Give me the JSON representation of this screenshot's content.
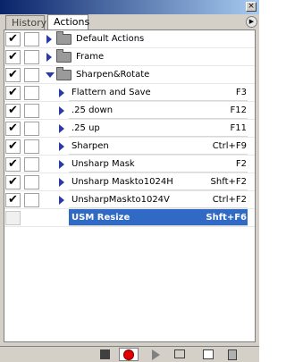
{
  "tabs": [
    {
      "label": "History",
      "active": false
    },
    {
      "label": "Actions",
      "active": true
    }
  ],
  "colors": {
    "selection": "#316ac5",
    "triangle": "#2a3aa8",
    "panel": "#d4d0c8"
  },
  "rows": [
    {
      "kind": "set",
      "label": "Default Actions",
      "expanded": false,
      "checked": true,
      "dialog": false,
      "icon": "folder-icon"
    },
    {
      "kind": "set",
      "label": "Frame",
      "expanded": false,
      "checked": true,
      "dialog": false,
      "icon": "folder-icon"
    },
    {
      "kind": "set",
      "label": "Sharpen&Rotate",
      "expanded": true,
      "checked": true,
      "dialog": false,
      "icon": "folder-icon"
    },
    {
      "kind": "action",
      "label": "Flattern and Save",
      "shortcut": "F3",
      "checked": true,
      "dialog": false
    },
    {
      "kind": "action",
      "label": ".25 down",
      "shortcut": "F12",
      "checked": true,
      "dialog": false
    },
    {
      "kind": "action",
      "label": ".25 up",
      "shortcut": "F11",
      "checked": true,
      "dialog": false
    },
    {
      "kind": "action",
      "label": "Sharpen",
      "shortcut": "Ctrl+F9",
      "checked": true,
      "dialog": false
    },
    {
      "kind": "action",
      "label": "Unsharp Mask",
      "shortcut": "F2",
      "checked": true,
      "dialog": false
    },
    {
      "kind": "action",
      "label": "Unsharp Maskto1024H",
      "shortcut": "Shft+F2",
      "checked": true,
      "dialog": false
    },
    {
      "kind": "action",
      "label": "UnsharpMaskto1024V",
      "shortcut": "Ctrl+F2",
      "checked": true,
      "dialog": false
    },
    {
      "kind": "action",
      "label": "USM Resize",
      "shortcut": "Shft+F6",
      "checked": false,
      "dialog": false,
      "selected": true,
      "expanded": true
    }
  ],
  "toolbar": [
    "stop-icon",
    "record-icon",
    "play-icon",
    "new-set-icon",
    "new-action-icon",
    "trash-icon"
  ]
}
